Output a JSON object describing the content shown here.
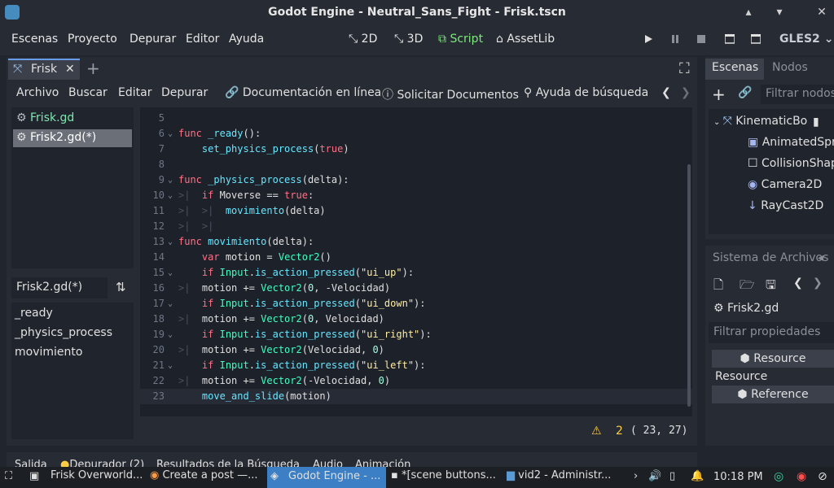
{
  "window": {
    "title": "Godot Engine - Neutral_Sans_Fight - Frisk.tscn"
  },
  "menu": {
    "items": [
      "Escenas",
      "Proyecto",
      "Depurar",
      "Editor",
      "Ayuda"
    ],
    "workspaces": [
      "2D",
      "3D",
      "Script",
      "AssetLib"
    ],
    "active_workspace": "Script",
    "renderer": "GLES2"
  },
  "scene_tab": {
    "label": "Frisk"
  },
  "script_toolbar": [
    "Archivo",
    "Buscar",
    "Editar",
    "Depurar",
    "Documentación en línea",
    "Solicitar Documentos",
    "Ayuda de búsqueda"
  ],
  "scripts": [
    {
      "label": "Frisk.gd",
      "selected": false
    },
    {
      "label": "Frisk2.gd(*)",
      "selected": true
    }
  ],
  "method_filter": {
    "value": "Frisk2.gd(*)"
  },
  "methods": [
    "_ready",
    "_physics_process",
    "movimiento"
  ],
  "code_lines": [
    {
      "n": "5",
      "text": ""
    },
    {
      "n": "6",
      "text": "func _ready():"
    },
    {
      "n": "7",
      "text": "    set_physics_process(true)"
    },
    {
      "n": "8",
      "text": ""
    },
    {
      "n": "9",
      "text": "func _physics_process(delta):"
    },
    {
      "n": "10",
      "text": "    if Moverse == true:"
    },
    {
      "n": "11",
      "text": "        movimiento(delta)"
    },
    {
      "n": "12",
      "text": ""
    },
    {
      "n": "13",
      "text": "func movimiento(delta):"
    },
    {
      "n": "14",
      "text": "    var motion = Vector2()"
    },
    {
      "n": "15",
      "text": "    if Input.is_action_pressed(\"ui_up\"):"
    },
    {
      "n": "16",
      "text": "        motion += Vector2(0, -Velocidad)"
    },
    {
      "n": "17",
      "text": "    if Input.is_action_pressed(\"ui_down\"):"
    },
    {
      "n": "18",
      "text": "        motion += Vector2(0, Velocidad)"
    },
    {
      "n": "19",
      "text": "    if Input.is_action_pressed(\"ui_right\"):"
    },
    {
      "n": "20",
      "text": "        motion += Vector2(Velocidad, 0)"
    },
    {
      "n": "21",
      "text": "    if Input.is_action_pressed(\"ui_left\"):"
    },
    {
      "n": "22",
      "text": "        motion += Vector2(-Velocidad, 0)"
    },
    {
      "n": "23",
      "text": "    move_and_slide(motion)"
    }
  ],
  "status": {
    "warnings": "2",
    "position": "( 23, 27)"
  },
  "bottom_tabs": [
    "Salida",
    "Depurador (2)",
    "Resultados de la Búsqueda",
    "Audio",
    "Animación"
  ],
  "scene_dock": {
    "tabs": [
      "Escenas",
      "Nodos"
    ],
    "filter_placeholder": "Filtrar nodos",
    "nodes": [
      "KinematicBo",
      "AnimatedSprite",
      "CollisionShape",
      "Camera2D",
      "RayCast2D"
    ]
  },
  "filesystem": {
    "title": "Sistema de Archivos",
    "current_file": "Frisk2.gd",
    "filter_placeholder": "Filtrar propiedades",
    "resource_button": "Resource",
    "resource_label": "Resource",
    "reference_button": "Reference"
  },
  "taskbar": {
    "tasks": [
      "Frisk Overworld...",
      "Create a post —...",
      "Godot Engine - ...",
      "*[scene buttons...",
      "vid2 - Administr..."
    ],
    "clock": "10:18 PM"
  },
  "colors": {
    "accent": "#478cbf",
    "keyword": "#ff7085",
    "function": "#66e6ff",
    "type": "#42ffc2",
    "string": "#ffeda1",
    "active_workspace": "#7ee87e",
    "warning": "#ffcc44"
  }
}
